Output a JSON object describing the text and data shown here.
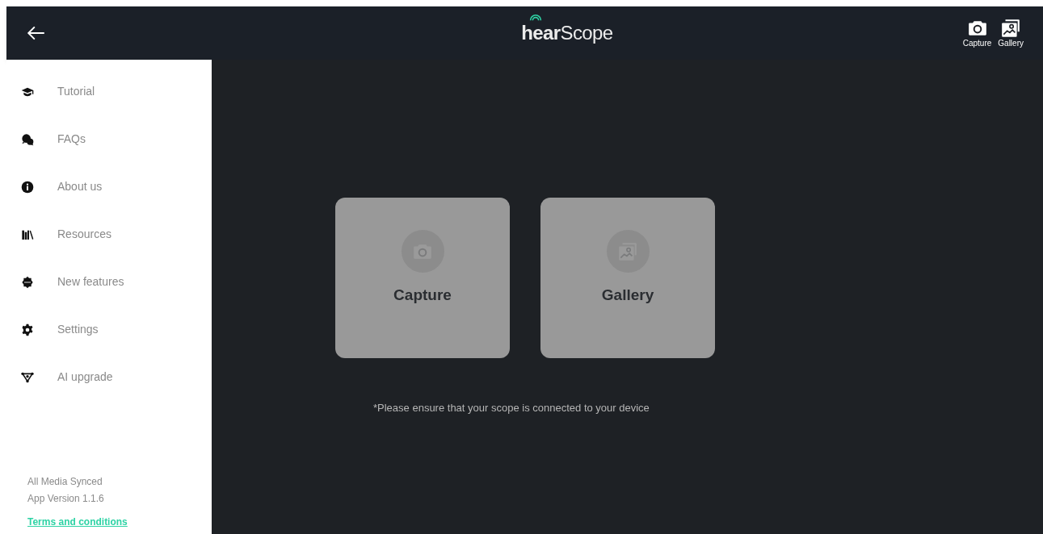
{
  "header": {
    "logo": "**hear**Scope",
    "actions": [
      {
        "kind": "capture",
        "label": "Capture"
      },
      {
        "kind": "gallery",
        "label": "Gallery"
      }
    ]
  },
  "sidebar": {
    "items": [
      {
        "kind": "tutorial",
        "label": "Tutorial"
      },
      {
        "kind": "faq",
        "label": "FAQs"
      },
      {
        "kind": "about",
        "label": "About us"
      },
      {
        "kind": "resources",
        "label": "Resources"
      },
      {
        "kind": "new",
        "label": "New features"
      },
      {
        "kind": "settings",
        "label": "Settings"
      },
      {
        "kind": "ai",
        "label": "AI upgrade"
      }
    ],
    "status": "All Media Synced",
    "version": "App Version 1.1.6",
    "terms_link": "Terms and conditions"
  },
  "cards": [
    {
      "kind": "capture",
      "label": "Capture"
    },
    {
      "kind": "gallery",
      "label": "Gallery"
    }
  ],
  "note": "*Please ensure that your scope is connected to your device"
}
